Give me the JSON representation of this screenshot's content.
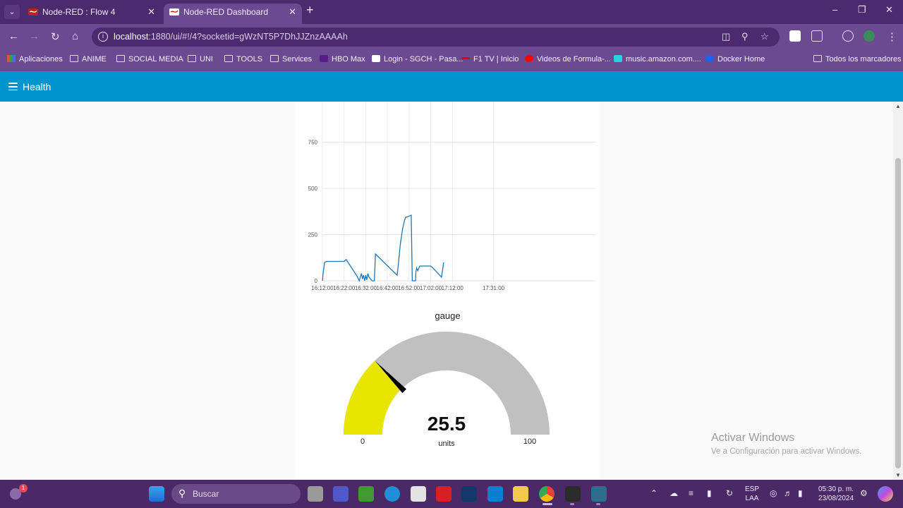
{
  "browser": {
    "tabs": [
      {
        "title": "Node-RED : Flow 4",
        "active": false
      },
      {
        "title": "Node-RED Dashboard",
        "active": true
      }
    ],
    "url_host": "localhost",
    "url_rest": ":1880/ui/#!/4?socketid=gWzNT5P7DhJJZnzAAAAh",
    "bookmarks": [
      "Aplicaciones",
      "ANIME",
      "SOCIAL MEDIA",
      "UNI",
      "TOOLS",
      "Services",
      "HBO Max",
      "Login - SGCH - Pasa...",
      "F1 TV | Inicio",
      "Videos de Formula-...",
      "music.amazon.com....",
      "Docker Home",
      "Todos los marcadores"
    ]
  },
  "dashboard": {
    "title": "Health",
    "header_color": "#0094ce"
  },
  "chart_data": {
    "type": "line",
    "title": "",
    "xlabel": "",
    "ylabel": "",
    "x_ticks": [
      "16:12:00",
      "16:22:00",
      "16:32:00",
      "16:42:00",
      "16:52:00",
      "17:02:00",
      "17:12:00",
      "17:31:00"
    ],
    "y_ticks": [
      0,
      250,
      500,
      750
    ],
    "ylim": [
      0,
      1000
    ],
    "color": "#1f77b4",
    "series": [
      {
        "x": [
          "16:12:00",
          "16:12:20",
          "16:13:00",
          "16:14:00",
          "16:22:00",
          "16:23:00",
          "16:28:00",
          "16:29:00",
          "16:30:00",
          "16:30:30",
          "16:31:00",
          "16:31:30",
          "16:32:00",
          "16:32:30",
          "16:33:00",
          "16:33:30",
          "16:35:00",
          "16:36:00",
          "16:36:30",
          "16:46:30",
          "16:47:00",
          "16:48:00",
          "16:49:00",
          "16:50:00",
          "16:50:30",
          "16:51:00",
          "16:52:00",
          "16:53:00",
          "16:53:30",
          "16:55:00",
          "16:55:10",
          "16:55:30",
          "16:56:00",
          "16:57:00",
          "17:02:00",
          "17:03:00",
          "17:07:00",
          "17:07:30",
          "17:08:00"
        ],
        "y": [
          0,
          40,
          100,
          105,
          105,
          115,
          25,
          0,
          40,
          10,
          30,
          0,
          30,
          5,
          40,
          20,
          0,
          0,
          145,
          30,
          80,
          200,
          280,
          330,
          345,
          345,
          350,
          355,
          0,
          0,
          45,
          70,
          55,
          80,
          80,
          70,
          20,
          60,
          100
        ]
      }
    ]
  },
  "gauge": {
    "title": "gauge",
    "value": "25.5",
    "units": "units",
    "min": "0",
    "max": "100",
    "fraction": 0.255,
    "fill_color": "#e6e600",
    "track_color": "#c0c0c0"
  },
  "watermark": {
    "line1": "Activar Windows",
    "line2": "Ve a Configuración para activar Windows."
  },
  "taskbar": {
    "search_placeholder": "Buscar",
    "lang_top": "ESP",
    "lang_bottom": "LAA",
    "time": "05:30 p. m.",
    "date": "23/08/2024",
    "notification_count": "1",
    "teams_badge": "1"
  }
}
